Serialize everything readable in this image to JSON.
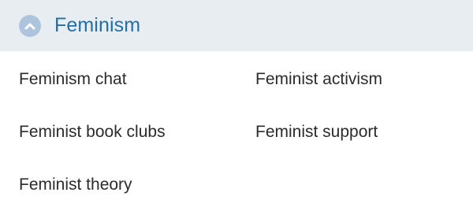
{
  "section": {
    "title": "Feminism",
    "toggle_icon": "chevron-up-icon",
    "header_bg": "#e8edf2",
    "title_color": "#1f6fa8",
    "icon_bg": "#aec4dd"
  },
  "items": [
    {
      "label": "Feminism chat"
    },
    {
      "label": "Feminist activism"
    },
    {
      "label": "Feminist book clubs"
    },
    {
      "label": "Feminist support"
    },
    {
      "label": "Feminist theory"
    }
  ]
}
